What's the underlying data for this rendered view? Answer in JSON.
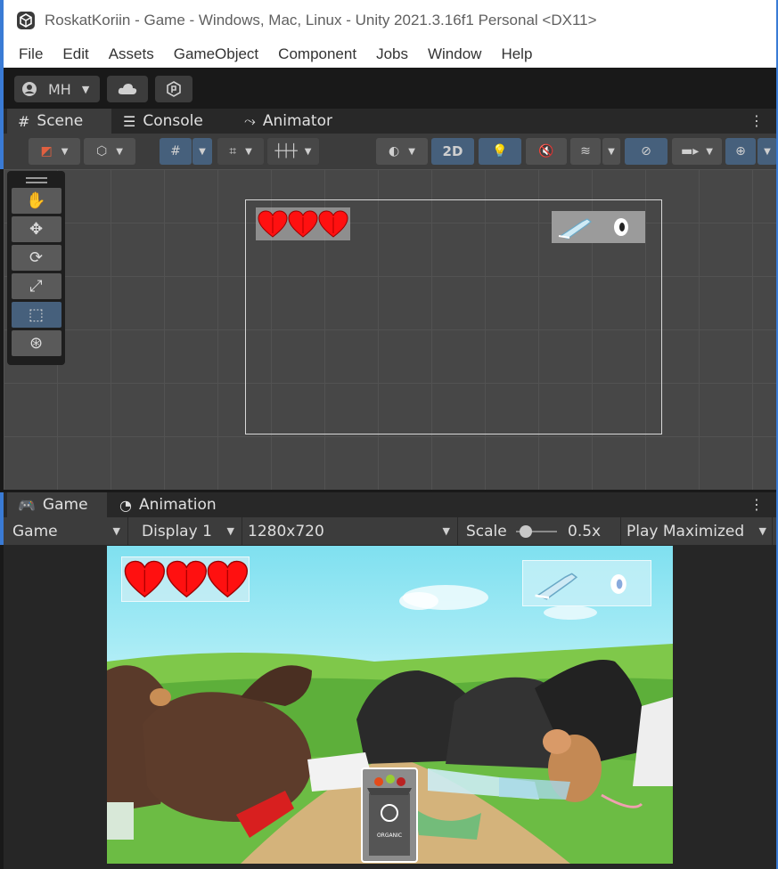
{
  "window": {
    "title": "RoskatKoriin - Game - Windows, Mac, Linux - Unity 2021.3.16f1 Personal <DX11>",
    "accent": "#3a7bd5"
  },
  "menu": [
    "File",
    "Edit",
    "Assets",
    "GameObject",
    "Component",
    "Jobs",
    "Window",
    "Help"
  ],
  "account": {
    "initials": "MH",
    "icons": [
      "user-icon",
      "cloud-icon",
      "collab-icon"
    ]
  },
  "scene_panel": {
    "tabs": [
      {
        "label": "Scene",
        "icon": "grid-icon",
        "active": true
      },
      {
        "label": "Console",
        "icon": "console-icon",
        "active": false
      },
      {
        "label": "Animator",
        "icon": "animator-icon",
        "active": false
      }
    ],
    "mode_2d": "2D",
    "tools": [
      "hand-tool-icon",
      "move-tool-icon",
      "rotate-tool-icon",
      "scale-tool-icon",
      "rect-tool-icon",
      "transform-tool-icon"
    ],
    "selected_tool": "rect-tool-icon",
    "hearts": 3
  },
  "game_panel": {
    "tabs": [
      {
        "label": "Game",
        "icon": "gamepad-icon",
        "active": true
      },
      {
        "label": "Animation",
        "icon": "clock-icon",
        "active": false
      }
    ],
    "view_mode": "Game",
    "display": "Display 1",
    "resolution": "1280x720",
    "scale_label": "Scale",
    "scale_value": "0.5x",
    "play_mode": "Play Maximized",
    "hearts": 3,
    "bin_label": "ORGANIC"
  },
  "colors": {
    "heart": "#ff1010",
    "sky": "#8fe4f2",
    "grass": "#4fae3a",
    "path": "#c9a36a"
  }
}
